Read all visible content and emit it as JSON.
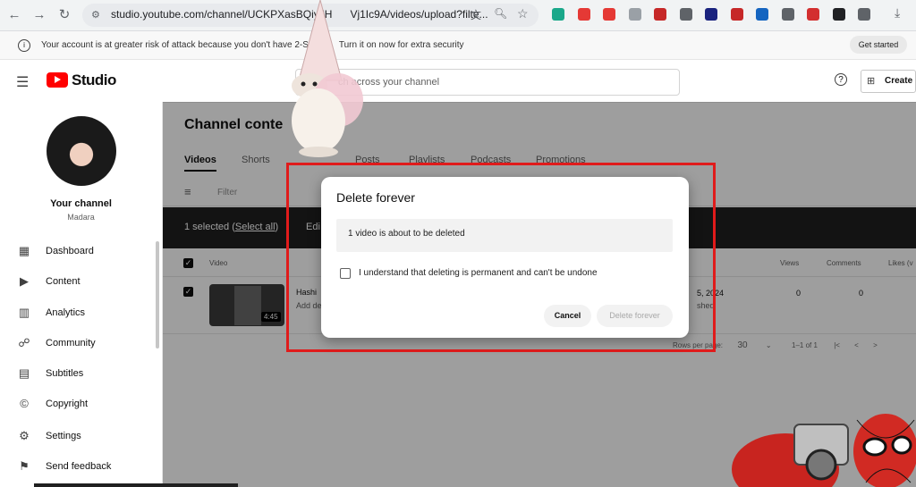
{
  "browser": {
    "url": "studio.youtube.com/channel/UCKPXasBQiyJH",
    "url_tail": "Vj1Ic9A/videos/upload?filte...",
    "ext_colors": [
      "#1aa88a",
      "#e53935",
      "#e53935",
      "#9aa0a6",
      "#c62828",
      "#5f6368",
      "#1a237e",
      "#c62828",
      "#1565c0",
      "#5f6368",
      "#d32f2f",
      "#202124",
      "#5f6368"
    ]
  },
  "banner": {
    "text": "Your account is at greater risk of attack because you don't have 2-Step",
    "text_tail": "Turn it on now for extra security",
    "button": "Get started"
  },
  "header": {
    "brand": "Studio",
    "search_placeholder": "ch across your channel",
    "create_label": "Create"
  },
  "sidebar": {
    "channel_title": "Your channel",
    "channel_name": "Madara",
    "items": [
      {
        "label": "Dashboard",
        "icon": "dashboard-icon",
        "glyph": "▦"
      },
      {
        "label": "Content",
        "icon": "content-icon",
        "glyph": "▶"
      },
      {
        "label": "Analytics",
        "icon": "analytics-icon",
        "glyph": "▥"
      },
      {
        "label": "Community",
        "icon": "community-icon",
        "glyph": "☍"
      },
      {
        "label": "Subtitles",
        "icon": "subtitles-icon",
        "glyph": "▤"
      },
      {
        "label": "Copyright",
        "icon": "copyright-icon",
        "glyph": "©"
      },
      {
        "label": "Settings",
        "icon": "settings-icon",
        "glyph": "⚙"
      },
      {
        "label": "Send feedback",
        "icon": "feedback-icon",
        "glyph": "⚑"
      }
    ]
  },
  "content": {
    "title": "Channel conte",
    "tabs": [
      "Videos",
      "Shorts",
      "Posts",
      "Playlists",
      "Podcasts",
      "Promotions"
    ],
    "filter_label": "Filter",
    "selected_text": "1 selected (",
    "select_all": "Select all",
    "selected_close": ")",
    "edit_label": "Edi",
    "columns": {
      "video": "Video",
      "views": "Views",
      "comments": "Comments",
      "likes": "Likes (v"
    },
    "row": {
      "title": "Hashi",
      "desc": "Add de",
      "duration": "4:45",
      "date": "5, 2024",
      "status": "shed",
      "views": "0",
      "comments": "0"
    },
    "pager": {
      "rows_label": "Rows per page:",
      "rows_value": "30",
      "range": "1–1 of 1"
    }
  },
  "dialog": {
    "title": "Delete forever",
    "info": "1 video is about to be deleted",
    "checkbox_label": "I understand that deleting is permanent and can't be undone",
    "checkbox_checked": false,
    "cancel": "Cancel",
    "delete": "Delete forever"
  }
}
